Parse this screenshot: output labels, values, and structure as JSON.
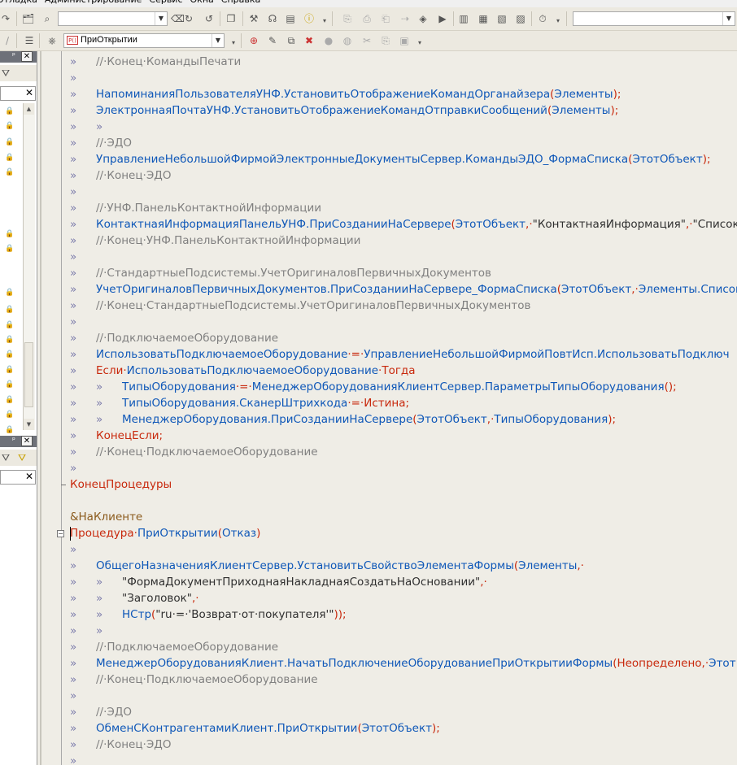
{
  "menubar": {
    "items": [
      "Отладка",
      "Администрирование",
      "Сервис",
      "Окна",
      "Справка"
    ]
  },
  "toolbar": {
    "search_combo_value": "",
    "right_combo_value": "",
    "procedure_combo_value": "ПриОткрытии",
    "procedure_combo_icon": "P()"
  },
  "left_panel": {
    "close_label": "✕",
    "search_clear": "✕",
    "pin": "ᵖ"
  },
  "code_lines": [
    {
      "i": 1,
      "t": [
        [
          "cm",
          "//·Конец·КомандыПечати"
        ]
      ]
    },
    {
      "i": 1,
      "t": []
    },
    {
      "i": 1,
      "t": [
        [
          "id",
          "НапоминанияПользователяУНФ.УстановитьОтображениеКомандОрганайзера"
        ],
        [
          "op",
          "("
        ],
        [
          "id",
          "Элементы"
        ],
        [
          "op",
          ");"
        ]
      ]
    },
    {
      "i": 1,
      "t": [
        [
          "id",
          "ЭлектроннаяПочтаУНФ.УстановитьОтображениеКомандОтправкиСообщений"
        ],
        [
          "op",
          "("
        ],
        [
          "id",
          "Элементы"
        ],
        [
          "op",
          ");"
        ]
      ]
    },
    {
      "i": 2,
      "t": []
    },
    {
      "i": 1,
      "t": [
        [
          "cm",
          "//·ЭДО"
        ]
      ]
    },
    {
      "i": 1,
      "t": [
        [
          "id",
          "УправлениеНебольшойФирмойЭлектронныеДокументыСервер.КомандыЭДО_ФормаСписка"
        ],
        [
          "op",
          "("
        ],
        [
          "id",
          "ЭтотОбъект"
        ],
        [
          "op",
          ");"
        ]
      ]
    },
    {
      "i": 1,
      "t": [
        [
          "cm",
          "//·Конец·ЭДО"
        ]
      ]
    },
    {
      "i": 1,
      "t": []
    },
    {
      "i": 1,
      "t": [
        [
          "cm",
          "//·УНФ.ПанельКонтактнойИнформации"
        ]
      ]
    },
    {
      "i": 1,
      "t": [
        [
          "id",
          "КонтактнаяИнформацияПанельУНФ.ПриСозданииНаСервере"
        ],
        [
          "op",
          "("
        ],
        [
          "id",
          "ЭтотОбъект"
        ],
        [
          "op",
          ",·"
        ],
        [
          "st",
          "\"КонтактнаяИнформация\""
        ],
        [
          "op",
          ",·"
        ],
        [
          "st",
          "\"Список"
        ]
      ]
    },
    {
      "i": 1,
      "t": [
        [
          "cm",
          "//·Конец·УНФ.ПанельКонтактнойИнформации"
        ]
      ]
    },
    {
      "i": 1,
      "t": []
    },
    {
      "i": 1,
      "t": [
        [
          "cm",
          "//·СтандартныеПодсистемы.УчетОригиналовПервичныхДокументов"
        ]
      ]
    },
    {
      "i": 1,
      "t": [
        [
          "id",
          "УчетОригиналовПервичныхДокументов.ПриСозданииНаСервере_ФормаСписка"
        ],
        [
          "op",
          "("
        ],
        [
          "id",
          "ЭтотОбъект"
        ],
        [
          "op",
          ",·"
        ],
        [
          "id",
          "Элементы.Список"
        ]
      ]
    },
    {
      "i": 1,
      "t": [
        [
          "cm",
          "//·Конец·СтандартныеПодсистемы.УчетОригиналовПервичныхДокументов"
        ]
      ]
    },
    {
      "i": 1,
      "t": []
    },
    {
      "i": 1,
      "t": [
        [
          "cm",
          "//·ПодключаемоеОборудование"
        ]
      ]
    },
    {
      "i": 1,
      "t": [
        [
          "id",
          "ИспользоватьПодключаемоеОборудование"
        ],
        [
          "op",
          "·=·"
        ],
        [
          "id",
          "УправлениеНебольшойФирмойПовтИсп.ИспользоватьПодключ"
        ]
      ]
    },
    {
      "i": 1,
      "t": [
        [
          "kw",
          "Если"
        ],
        [
          "op",
          "·"
        ],
        [
          "id",
          "ИспользоватьПодключаемоеОборудование"
        ],
        [
          "op",
          "·"
        ],
        [
          "kw",
          "Тогда"
        ]
      ]
    },
    {
      "i": 2,
      "t": [
        [
          "id",
          "ТипыОборудования"
        ],
        [
          "op",
          "·=·"
        ],
        [
          "id",
          "МенеджерОборудованияКлиентСервер.ПараметрыТипыОборудования"
        ],
        [
          "op",
          "();"
        ]
      ]
    },
    {
      "i": 2,
      "t": [
        [
          "id",
          "ТипыОборудования.СканерШтрихкода"
        ],
        [
          "op",
          "·=·"
        ],
        [
          "kw",
          "Истина"
        ],
        [
          "op",
          ";"
        ]
      ]
    },
    {
      "i": 2,
      "t": [
        [
          "id",
          "МенеджерОборудования.ПриСозданииНаСервере"
        ],
        [
          "op",
          "("
        ],
        [
          "id",
          "ЭтотОбъект"
        ],
        [
          "op",
          ",·"
        ],
        [
          "id",
          "ТипыОборудования"
        ],
        [
          "op",
          ");"
        ]
      ]
    },
    {
      "i": 1,
      "t": [
        [
          "kw",
          "КонецЕсли"
        ],
        [
          "op",
          ";"
        ]
      ]
    },
    {
      "i": 1,
      "t": [
        [
          "cm",
          "//·Конец·ПодключаемоеОборудование"
        ]
      ]
    },
    {
      "i": 1,
      "t": []
    },
    {
      "i": 0,
      "t": [
        [
          "kw",
          "КонецПроцедуры"
        ]
      ]
    },
    {
      "i": 0,
      "t": []
    },
    {
      "i": 0,
      "t": [
        [
          "pp",
          "&НаКлиенте"
        ]
      ]
    },
    {
      "i": 0,
      "t": [
        [
          "kw",
          "Процедура"
        ],
        [
          "op",
          "·"
        ],
        [
          "id",
          "ПриОткрытии"
        ],
        [
          "op",
          "("
        ],
        [
          "id",
          "Отказ"
        ],
        [
          "op",
          ")"
        ]
      ]
    },
    {
      "i": 1,
      "t": []
    },
    {
      "i": 1,
      "t": [
        [
          "id",
          "ОбщегоНазначенияКлиентСервер.УстановитьСвойствоЭлементаФормы"
        ],
        [
          "op",
          "("
        ],
        [
          "id",
          "Элементы"
        ],
        [
          "op",
          ",·"
        ]
      ]
    },
    {
      "i": 2,
      "t": [
        [
          "st",
          "\"ФормаДокументПриходнаяНакладнаяСоздатьНаОсновании\""
        ],
        [
          "op",
          ",·"
        ]
      ]
    },
    {
      "i": 2,
      "t": [
        [
          "st",
          "\"Заголовок\""
        ],
        [
          "op",
          ",·"
        ]
      ]
    },
    {
      "i": 2,
      "t": [
        [
          "id",
          "НСтр"
        ],
        [
          "op",
          "("
        ],
        [
          "st",
          "\"ru·=·'Возврат·от·покупателя'\""
        ],
        [
          "op",
          "));"
        ]
      ]
    },
    {
      "i": 2,
      "t": []
    },
    {
      "i": 1,
      "t": [
        [
          "cm",
          "//·ПодключаемоеОборудование"
        ]
      ]
    },
    {
      "i": 1,
      "t": [
        [
          "id",
          "МенеджерОборудованияКлиент.НачатьПодключениеОборудованиеПриОткрытииФормы"
        ],
        [
          "op",
          "("
        ],
        [
          "kw",
          "Неопределено"
        ],
        [
          "op",
          ",·"
        ],
        [
          "id",
          "Этот"
        ]
      ]
    },
    {
      "i": 1,
      "t": [
        [
          "cm",
          "//·Конец·ПодключаемоеОборудование"
        ]
      ]
    },
    {
      "i": 1,
      "t": []
    },
    {
      "i": 1,
      "t": [
        [
          "cm",
          "//·ЭДО"
        ]
      ]
    },
    {
      "i": 1,
      "t": [
        [
          "id",
          "ОбменСКонтрагентамиКлиент.ПриОткрытии"
        ],
        [
          "op",
          "("
        ],
        [
          "id",
          "ЭтотОбъект"
        ],
        [
          "op",
          ");"
        ]
      ]
    },
    {
      "i": 1,
      "t": [
        [
          "cm",
          "//·Конец·ЭДО"
        ]
      ]
    },
    {
      "i": 1,
      "t": []
    }
  ]
}
